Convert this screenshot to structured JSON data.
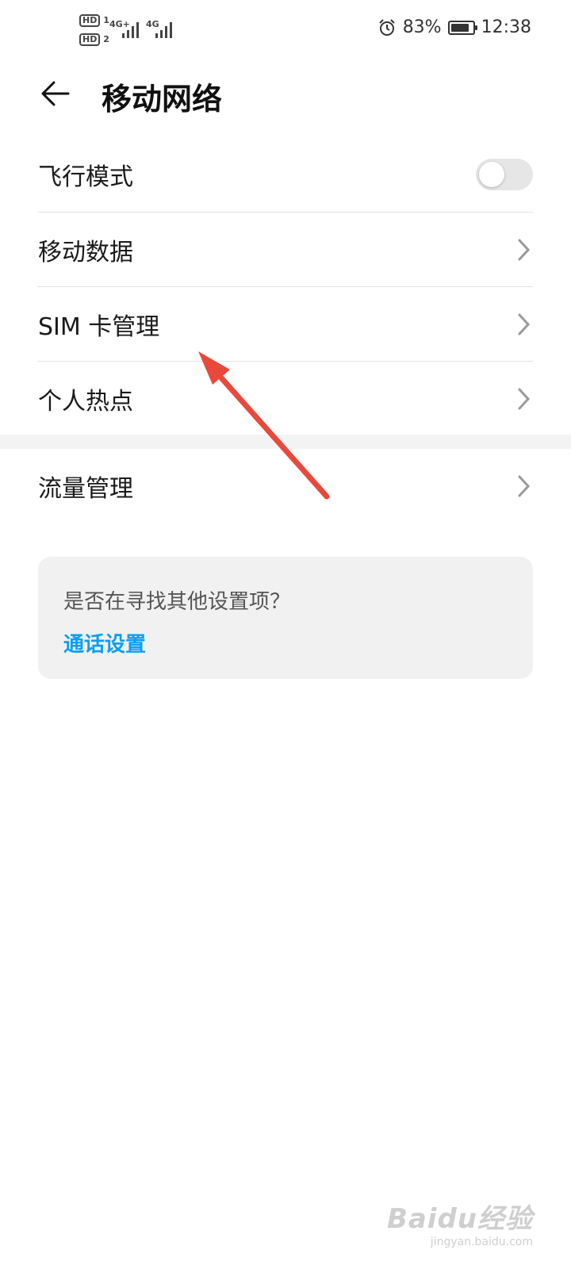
{
  "status_bar": {
    "sim1_badge": "HD",
    "sim1_num": "1",
    "sim2_badge": "HD",
    "sim2_num": "2",
    "net1": "4G+",
    "net2": "4G",
    "battery_percent": "83%",
    "battery_level": 0.83,
    "time": "12:38",
    "icons": [
      "alarm-icon",
      "battery-icon",
      "signal-icon"
    ]
  },
  "header": {
    "title": "移动网络",
    "back_icon": "back-arrow-icon"
  },
  "items": [
    {
      "label": "飞行模式",
      "control": "toggle",
      "toggle_on": false
    },
    {
      "label": "移动数据",
      "control": "chevron"
    },
    {
      "label": "SIM 卡管理",
      "control": "chevron"
    },
    {
      "label": "个人热点",
      "control": "chevron"
    },
    {
      "label": "流量管理",
      "control": "chevron"
    }
  ],
  "suggestion": {
    "question": "是否在寻找其他设置项？",
    "link": "通话设置"
  },
  "watermark": {
    "logo": "Baidu经验",
    "url": "jingyan.baidu.com"
  },
  "colors": {
    "accent_link": "#0a9ff0",
    "annotation_arrow": "#e8493b",
    "toggle_off": "#e6e6e6"
  }
}
